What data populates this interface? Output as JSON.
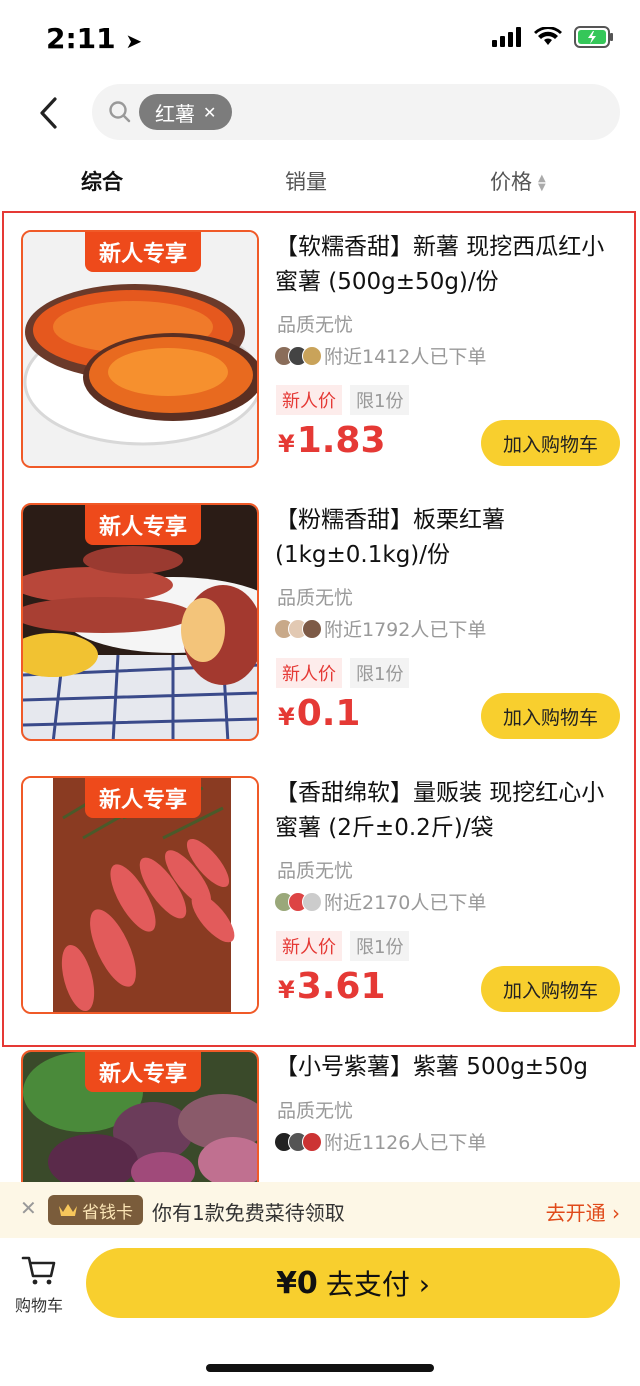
{
  "status": {
    "time": "2:11"
  },
  "search": {
    "tag": "红薯"
  },
  "sort": {
    "tabs": [
      "综合",
      "销量",
      "价格"
    ]
  },
  "products": [
    {
      "badge": "新人专享",
      "title": "【软糯香甜】新薯 现挖西瓜红小蜜薯 (500g±50g)/份",
      "quality": "品质无忧",
      "buyers": "附近1412人已下单",
      "tag_new": "新人价",
      "tag_limit": "限1份",
      "currency": "¥",
      "price": "1.83",
      "cart_label": "加入购物车"
    },
    {
      "badge": "新人专享",
      "title": "【粉糯香甜】板栗红薯 (1kg±0.1kg)/份",
      "quality": "品质无忧",
      "buyers": "附近1792人已下单",
      "tag_new": "新人价",
      "tag_limit": "限1份",
      "currency": "¥",
      "price": "0.1",
      "cart_label": "加入购物车"
    },
    {
      "badge": "新人专享",
      "title": "【香甜绵软】量贩装 现挖红心小蜜薯 (2斤±0.2斤)/袋",
      "quality": "品质无忧",
      "buyers": "附近2170人已下单",
      "tag_new": "新人价",
      "tag_limit": "限1份",
      "currency": "¥",
      "price": "3.61",
      "cart_label": "加入购物车"
    },
    {
      "badge": "新人专享",
      "title": "【小号紫薯】紫薯 500g±50g",
      "quality": "品质无忧",
      "buyers": "附近1126人已下单"
    }
  ],
  "promo": {
    "badge": "省钱卡",
    "text": "你有1款免费菜待领取",
    "action": "去开通 ›"
  },
  "bottom": {
    "cart_label": "购物车",
    "pay_amount": "¥0",
    "pay_label": "去支付 ›"
  },
  "colors": {
    "accent": "#f8cf2e",
    "price": "#e53935",
    "badge": "#ee4a1b"
  },
  "icons": [
    "back-arrow-icon",
    "search-icon",
    "close-icon",
    "sort-arrows-icon",
    "cart-icon",
    "crown-icon"
  ]
}
